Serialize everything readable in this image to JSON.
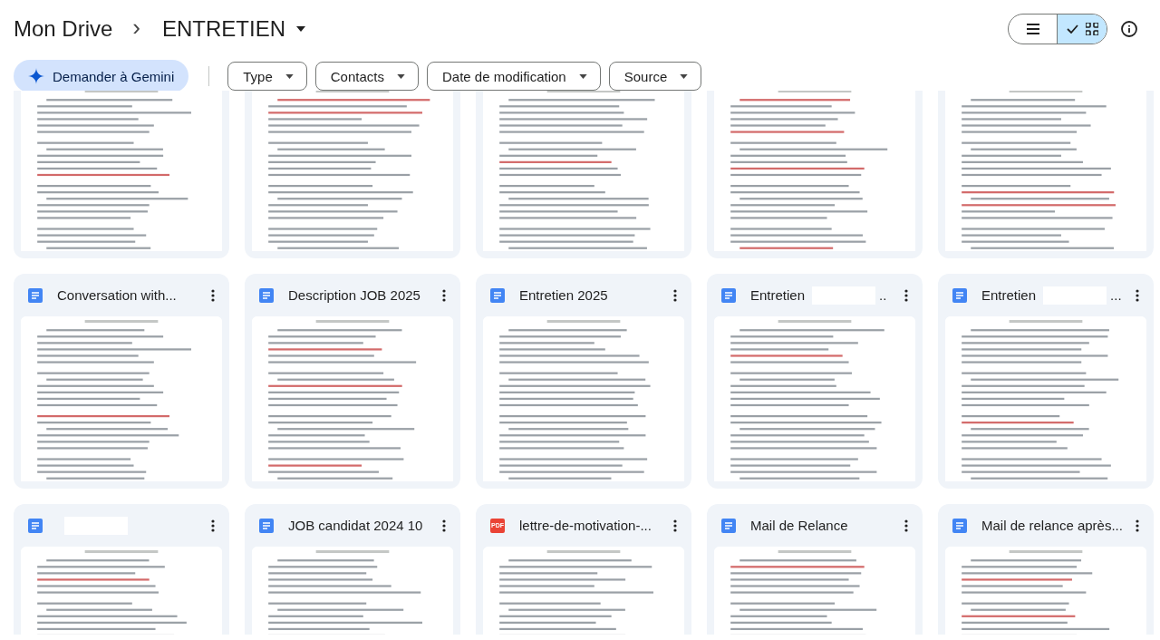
{
  "breadcrumb": [
    {
      "label": "Mon Drive"
    },
    {
      "label": "ENTRETIEN"
    }
  ],
  "breadcrumb_separator": "›",
  "view_toggle": [
    {
      "kind": "list",
      "selected": false
    },
    {
      "kind": "grid",
      "selected": true
    }
  ],
  "gemini_button": "Demander à Gemini",
  "filters": [
    {
      "label": "Type"
    },
    {
      "label": "Contacts"
    },
    {
      "label": "Date de modification"
    },
    {
      "label": "Source"
    }
  ],
  "files": [
    {
      "kind": "doc",
      "title": "Conversation with..."
    },
    {
      "kind": "doc",
      "title": "Description JOB 2025"
    },
    {
      "kind": "doc",
      "title": "Entretien 2025"
    },
    {
      "kind": "doc",
      "title": "Entretien",
      "redacted": true,
      "suffix": ".."
    },
    {
      "kind": "doc",
      "title": "Entretien",
      "redacted": true,
      "suffix": "..."
    },
    {
      "kind": "doc",
      "redacted": true
    },
    {
      "kind": "doc",
      "title": "JOB candidat 2024 10"
    },
    {
      "kind": "pdf",
      "icon_label": "PDF",
      "title": "lettre-de-motivation-..."
    },
    {
      "kind": "doc",
      "title": "Mail de Relance"
    },
    {
      "kind": "doc",
      "title": "Mail de relance après..."
    }
  ]
}
